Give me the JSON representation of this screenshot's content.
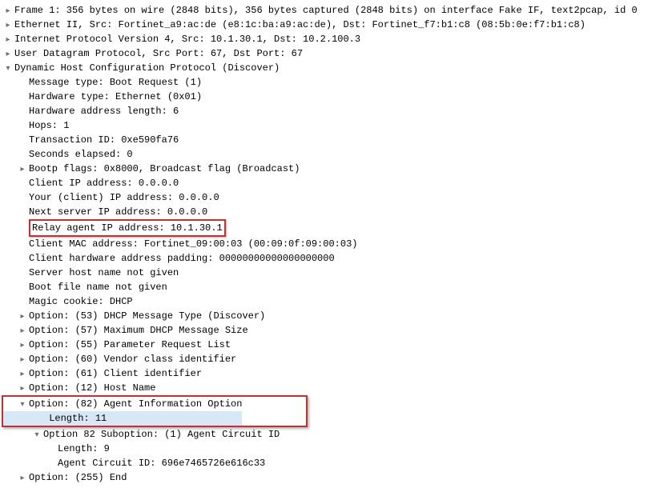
{
  "frame": {
    "line": "Frame 1: 356 bytes on wire (2848 bits), 356 bytes captured (2848 bits) on interface Fake IF, text2pcap, id 0"
  },
  "ethernet": {
    "line": "Ethernet II, Src: Fortinet_a9:ac:de (e8:1c:ba:a9:ac:de), Dst: Fortinet_f7:b1:c8 (08:5b:0e:f7:b1:c8)"
  },
  "ip": {
    "line": "Internet Protocol Version 4, Src: 10.1.30.1, Dst: 10.2.100.3"
  },
  "udp": {
    "line": "User Datagram Protocol, Src Port: 67, Dst Port: 67"
  },
  "dhcp": {
    "line": "Dynamic Host Configuration Protocol (Discover)",
    "message_type": "Message type: Boot Request (1)",
    "hardware_type": "Hardware type: Ethernet (0x01)",
    "hardware_addr_len": "Hardware address length: 6",
    "hops": "Hops: 1",
    "transaction_id": "Transaction ID: 0xe590fa76",
    "seconds_elapsed": "Seconds elapsed: 0",
    "bootp_flags": "Bootp flags: 0x8000, Broadcast flag (Broadcast)",
    "client_ip": "Client IP address: 0.0.0.0",
    "your_ip": "Your (client) IP address: 0.0.0.0",
    "next_server": "Next server IP address: 0.0.0.0",
    "relay_agent": "Relay agent IP address: 10.1.30.1",
    "client_mac": "Client MAC address: Fortinet_09:00:03 (00:09:0f:09:00:03)",
    "client_hw_padding": "Client hardware address padding: 00000000000000000000",
    "server_host": "Server host name not given",
    "boot_file": "Boot file name not given",
    "magic_cookie": "Magic cookie: DHCP",
    "option53": "Option: (53) DHCP Message Type (Discover)",
    "option57": "Option: (57) Maximum DHCP Message Size",
    "option55": "Option: (55) Parameter Request List",
    "option60": "Option: (60) Vendor class identifier",
    "option61": "Option: (61) Client identifier",
    "option12": "Option: (12) Host Name",
    "option82": "Option: (82) Agent Information Option",
    "option82_length": "Length: 11",
    "option82_sub": "Option 82 Suboption: (1) Agent Circuit ID",
    "option82_sub_length": "Length: 9",
    "option82_sub_id": "Agent Circuit ID: 696e7465726e616c33",
    "option255": "Option: (255) End"
  }
}
